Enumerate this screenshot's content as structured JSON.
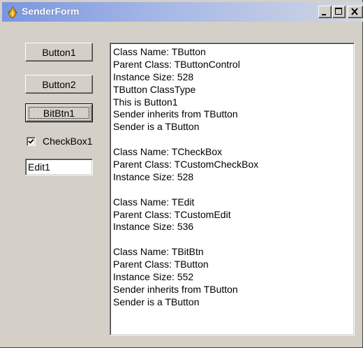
{
  "window": {
    "title": "SenderForm",
    "title_icon": "delphi-flame-icon",
    "controls": [
      "minimize-icon",
      "maximize-icon",
      "close-icon"
    ]
  },
  "buttons": [
    {
      "label": "Button1"
    },
    {
      "label": "Button2"
    },
    {
      "label": "BitBtn1",
      "focused": true
    }
  ],
  "checkbox": {
    "label": "CheckBox1",
    "checked": true
  },
  "edit": {
    "value": "Edit1"
  },
  "memo": {
    "lines": [
      "Class Name: TButton",
      "Parent Class: TButtonControl",
      "Instance Size: 528",
      "TButton ClassType",
      "This is Button1",
      "Sender inherits from TButton",
      "Sender is a TButton",
      "",
      "Class Name: TCheckBox",
      "Parent Class: TCustomCheckBox",
      "Instance Size: 528",
      "",
      "Class Name: TEdit",
      "Parent Class: TCustomEdit",
      "Instance Size: 536",
      "",
      "Class Name: TBitBtn",
      "Parent Class: TButton",
      "Instance Size: 552",
      "Sender inherits from TButton",
      "Sender is a TButton"
    ]
  },
  "colors": {
    "face": "#d4d0c8",
    "title_gradient_start": "#7a96df",
    "title_gradient_end": "#d0d6e4"
  }
}
